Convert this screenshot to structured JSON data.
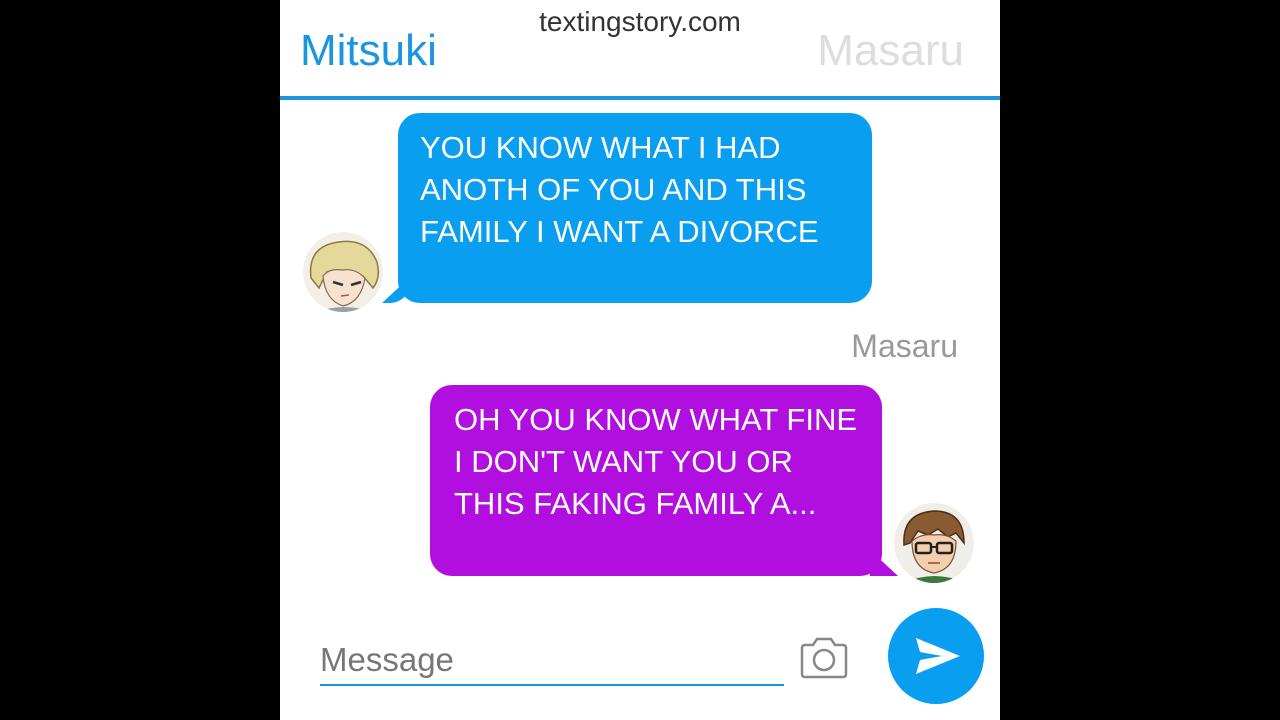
{
  "watermark": "textingstory.com",
  "header": {
    "left_contact": "Mitsuki",
    "right_contact": "Masaru"
  },
  "messages": [
    {
      "sender": "Mitsuki",
      "side": "left",
      "text": "YOU KNOW WHAT I HAD ANOTH OF YOU AND THIS FAMILY I WANT A DIVORCE"
    },
    {
      "sender": "Masaru",
      "side": "right",
      "label": "Masaru",
      "text": "OH YOU KNOW WHAT FINE I DON'T WANT YOU OR THIS FAKING FAMILY A..."
    }
  ],
  "composer": {
    "placeholder": "Message",
    "camera_icon": "camera-icon",
    "send_icon": "send-icon"
  },
  "colors": {
    "accent_blue": "#0a9ef0",
    "bubble_purple": "#b10fe0",
    "header_inactive": "#dddddd"
  }
}
